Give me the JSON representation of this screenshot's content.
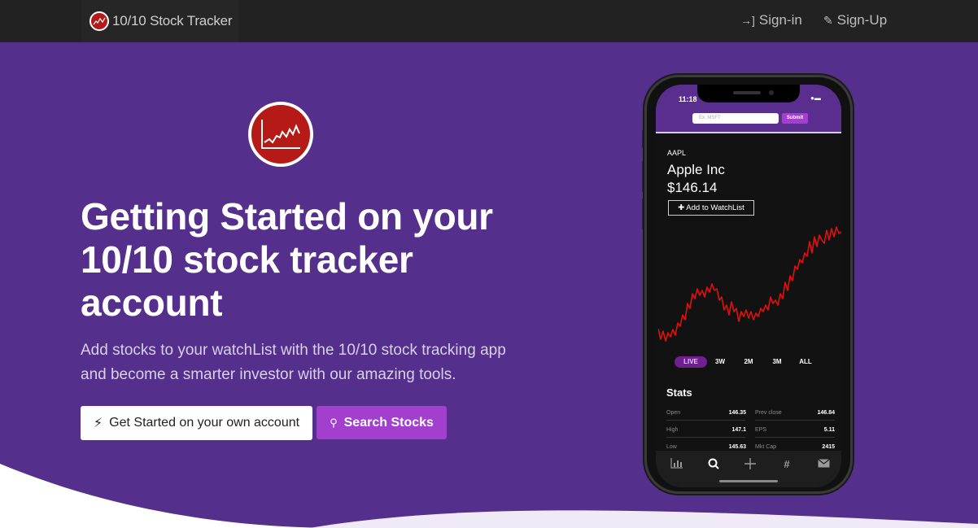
{
  "nav": {
    "brand_name": "10/10 Stock Tracker",
    "signin_label": "Sign-in",
    "signup_label": "Sign-Up"
  },
  "hero": {
    "title_line1": "Getting Started on your",
    "title_line2": "10/10 stock tracker",
    "title_line3": "account",
    "subtitle_line1": "Add stocks to your watchList with the 10/10 stock tracking app",
    "subtitle_line2": "and become a smarter investor with our amazing tools.",
    "primary_button": "Get Started on your own account",
    "search_button": "Search Stocks"
  },
  "phone": {
    "time": "11:18",
    "search_placeholder": "Ex: MSFT",
    "submit_label": "Submit",
    "ticker": "AAPL",
    "company": "Apple Inc",
    "price": "$146.14",
    "watchlist_button": "Add to WatchList",
    "ranges": [
      "LIVE",
      "3W",
      "2M",
      "3M",
      "ALL"
    ],
    "stats_title": "Stats",
    "stats": [
      {
        "label": "Open",
        "value": "146.35",
        "label2": "Prev close",
        "value2": "146.84"
      },
      {
        "label": "High",
        "value": "147.1",
        "label2": "EPS",
        "value2": "5.11"
      },
      {
        "label": "Low",
        "value": "145.63",
        "label2": "Mkt Cap",
        "value2": "2415"
      }
    ],
    "tabs": [
      "chart-icon",
      "search-icon",
      "plus-icon",
      "hash-icon",
      "mail-icon"
    ]
  },
  "colors": {
    "background": "#542f8c",
    "accent": "#a23fcf",
    "chart_line": "#e01010",
    "logo_red": "#b51a16"
  }
}
